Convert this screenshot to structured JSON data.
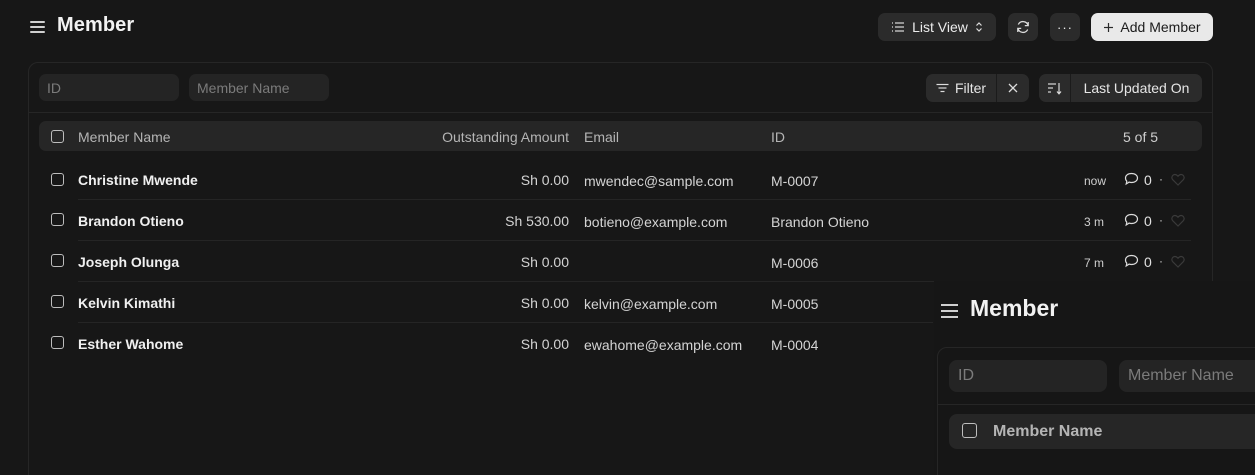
{
  "header": {
    "title": "Member",
    "list_view_label": "List View",
    "more_label": "···",
    "add_label": "Add Member"
  },
  "filters": {
    "id_placeholder": "ID",
    "name_placeholder": "Member Name",
    "filter_label": "Filter",
    "sort_label": "Last Updated On"
  },
  "table": {
    "columns": [
      "Member Name",
      "Outstanding Amount",
      "Email",
      "ID"
    ],
    "count_label": "5 of 5",
    "rows": [
      {
        "name": "Christine Mwende",
        "amount": "Sh 0.00",
        "email": "mwendec@sample.com",
        "id": "M-0007",
        "time": "now",
        "comments": "0"
      },
      {
        "name": "Brandon Otieno",
        "amount": "Sh 530.00",
        "email": "botieno@example.com",
        "id": "Brandon Otieno",
        "time": "3 m",
        "comments": "0"
      },
      {
        "name": "Joseph Olunga",
        "amount": "Sh 0.00",
        "email": "",
        "id": "M-0006",
        "time": "7 m",
        "comments": "0"
      },
      {
        "name": "Kelvin Kimathi",
        "amount": "Sh 0.00",
        "email": "kelvin@example.com",
        "id": "M-0005",
        "time": "",
        "comments": ""
      },
      {
        "name": "Esther Wahome",
        "amount": "Sh 0.00",
        "email": "ewahome@example.com",
        "id": "M-0004",
        "time": "",
        "comments": ""
      }
    ]
  },
  "overlay": {
    "title": "Member",
    "id_placeholder": "ID",
    "name_placeholder": "Member Name",
    "column": "Member Name"
  },
  "colors": {
    "background": "#171717",
    "surface": "#2b2b2b",
    "primary_button": "#e9e9e9"
  }
}
